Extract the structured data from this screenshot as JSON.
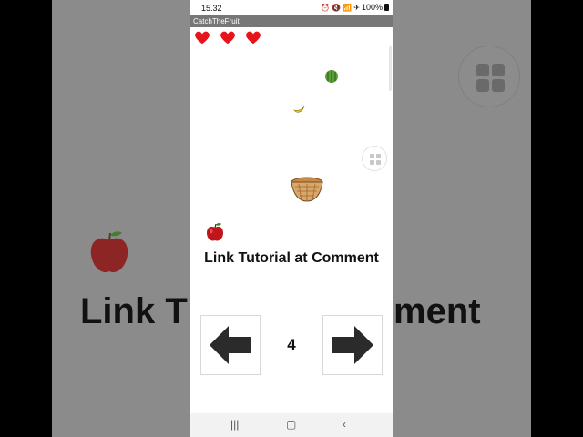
{
  "status_bar": {
    "time": "15.32",
    "icons": [
      "alarm-icon",
      "mute-icon",
      "wifi-icon",
      "airplane-icon"
    ],
    "battery": "100%"
  },
  "app": {
    "title": "CatchTheFruit"
  },
  "game": {
    "lives_remaining": 3,
    "hearts": [
      "heart-icon",
      "heart-icon",
      "heart-icon"
    ],
    "sprites": [
      "watermelon",
      "banana",
      "basket",
      "apple"
    ],
    "caption": "Link Tutorial at Comment",
    "score": "4",
    "controls": [
      "left-arrow-button",
      "right-arrow-button"
    ]
  },
  "background": {
    "text_left": "Link T",
    "text_right": "ment"
  },
  "colors": {
    "heart": "#e8141b",
    "title_bar": "#777777",
    "arrow": "#2b2b2b",
    "basket": "#d9a76a",
    "apple": "#c0161b"
  }
}
